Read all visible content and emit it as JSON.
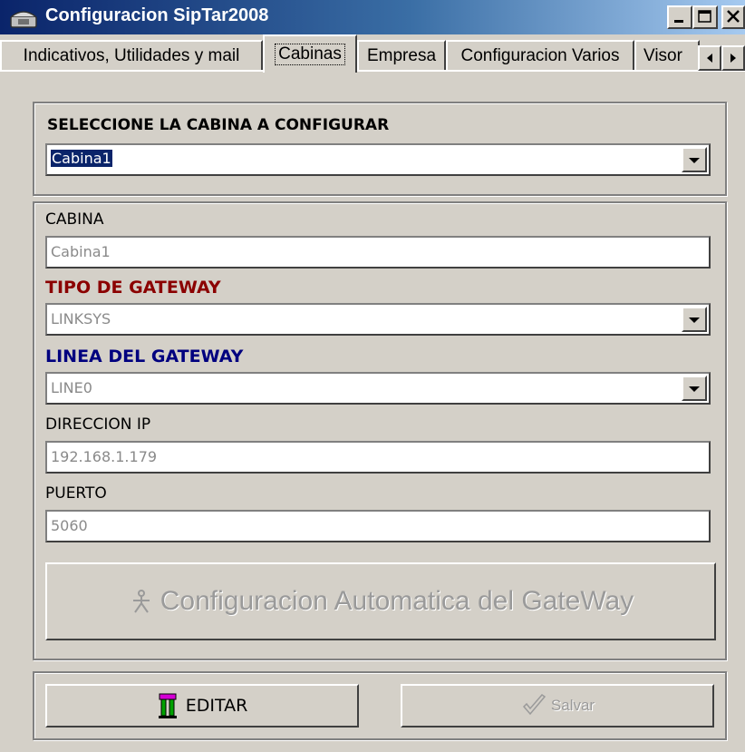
{
  "window": {
    "title": "Configuracion SipTar2008",
    "controls": [
      "minimize",
      "maximize",
      "close"
    ]
  },
  "tabs": [
    {
      "label": "Indicativos, Utilidades y mail",
      "active": false
    },
    {
      "label": "Cabinas",
      "active": true
    },
    {
      "label": "Empresa",
      "active": false
    },
    {
      "label": "Configuracion Varios",
      "active": false
    },
    {
      "label": "Visor",
      "active": false
    }
  ],
  "selector": {
    "label": "SELECCIONE LA CABINA A CONFIGURAR",
    "value": "Cabina1"
  },
  "form": {
    "cabina_label": "CABINA",
    "cabina_value": "Cabina1",
    "tipo_gateway_label": "TIPO DE GATEWAY",
    "tipo_gateway_value": "LINKSYS",
    "linea_gateway_label": "LINEA DEL GATEWAY",
    "linea_gateway_value": "LINE0",
    "ip_label": "DIRECCION IP",
    "ip_value": "192.168.1.179",
    "puerto_label": "PUERTO",
    "puerto_value": "5060",
    "auto_config_label": "Configuracion Automatica del GateWay"
  },
  "actions": {
    "edit_label": "EDITAR",
    "save_label": "Salvar"
  },
  "colors": {
    "title_gradient_start": "#0a246a",
    "tipo_gateway_label": "#8b0000",
    "linea_gateway_label": "#00007f",
    "disabled_text": "#9a9a9a",
    "window_face": "#d4d0c8"
  }
}
